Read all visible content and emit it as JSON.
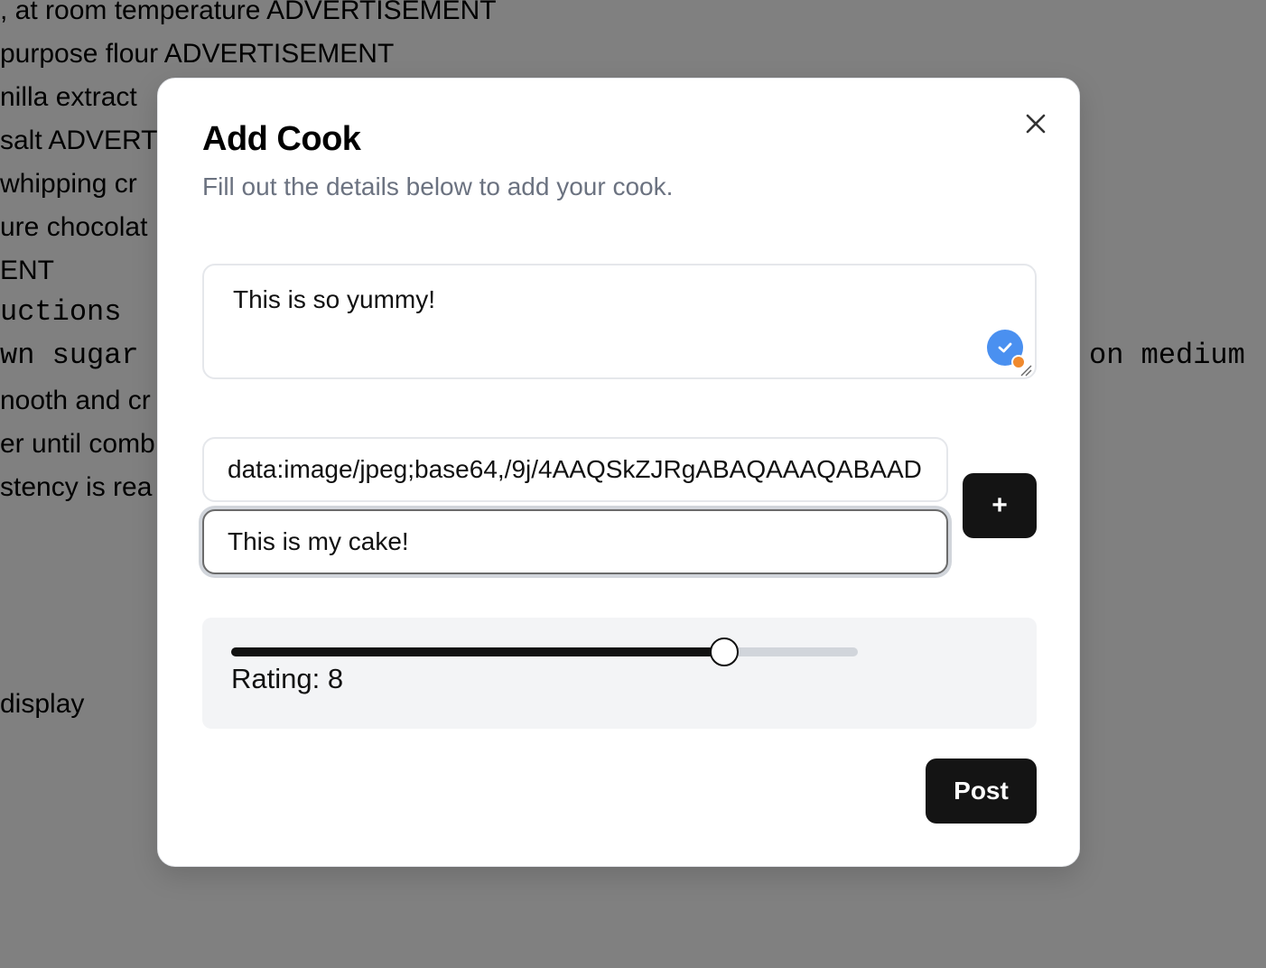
{
  "background": {
    "lines": [
      ", at room temperature ADVERTISEMENT",
      "purpose flour ADVERTISEMENT",
      "nilla extract",
      "salt ADVERT",
      " whipping cr",
      "ure chocolat",
      "ENT",
      "uctions",
      "wn sugar a",
      "on medium",
      "nooth and cr",
      "er until comb",
      "stency is rea",
      " display"
    ]
  },
  "modal": {
    "title": "Add Cook",
    "description": "Fill out the details below to add your cook.",
    "review_text": "This is so yummy!",
    "image_url_value": "data:image/jpeg;base64,/9j/4AAQSkZJRgABAQAAAQABAAD",
    "caption_value": "This is my cake!",
    "add_button_label": "+",
    "rating": {
      "value": 8,
      "min": 0,
      "max": 10,
      "label": "Rating: 8"
    },
    "post_button_label": "Post"
  }
}
